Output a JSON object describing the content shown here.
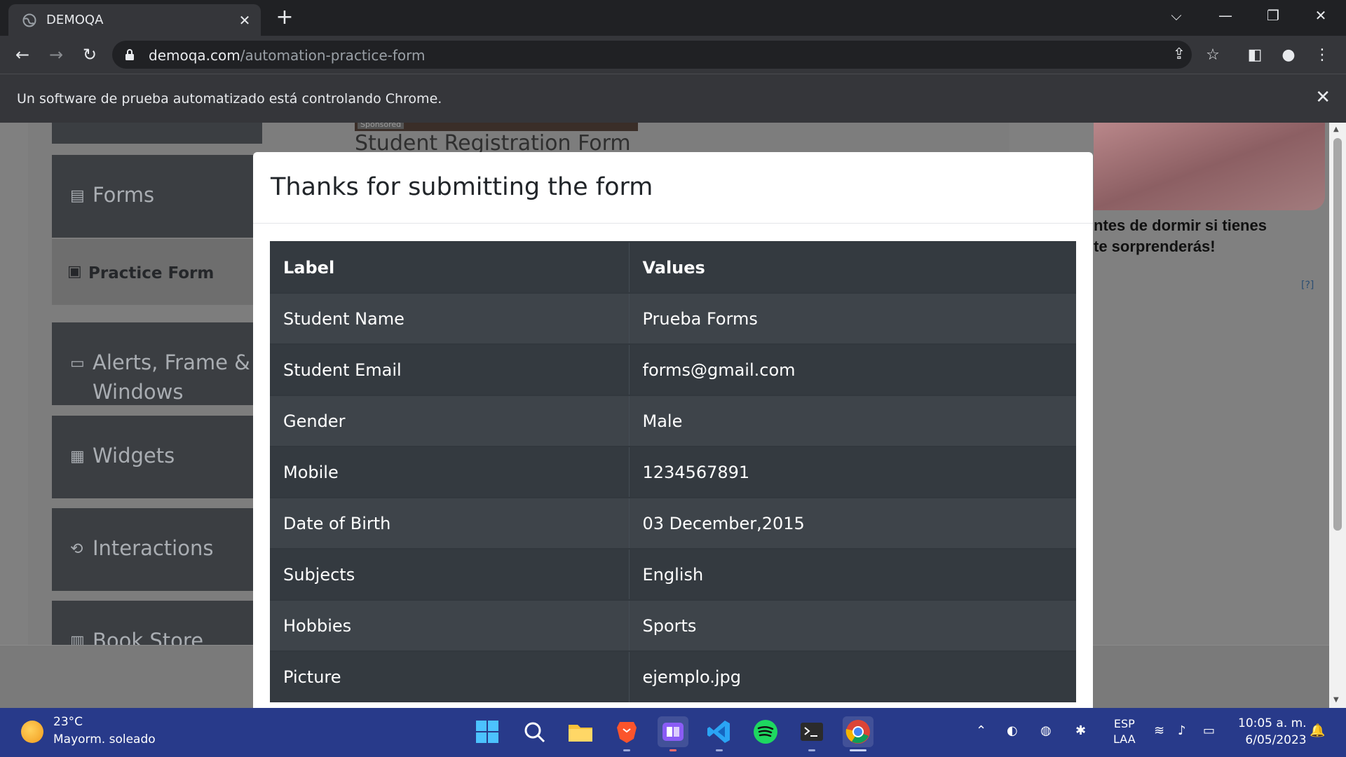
{
  "browser": {
    "tab_title": "DEMOQA",
    "tab_close": "✕",
    "new_tab": "+",
    "url_host": "demoqa.com",
    "url_path": "/automation-practice-form",
    "infobar_message": "Un software de prueba automatizado está controlando Chrome.",
    "infobar_close": "✕"
  },
  "sidebar": {
    "items": [
      {
        "label": "Forms",
        "icon": "forms-icon"
      },
      {
        "label": "Practice Form",
        "icon": "practice-form-icon"
      },
      {
        "label": "Alerts, Frame &",
        "label2": "Windows",
        "icon": "alerts-icon"
      },
      {
        "label": "Widgets",
        "icon": "widgets-icon"
      },
      {
        "label": "Interactions",
        "icon": "interactions-icon"
      },
      {
        "label": "Book Store",
        "icon": "book-store-icon"
      }
    ]
  },
  "page": {
    "heading": "Student Registration Form",
    "sponsored": "Sponsored"
  },
  "ad": {
    "line1": "ntes de dormir si tienes",
    "line2": "te sorprenderás!",
    "info": "[?]"
  },
  "modal": {
    "title": "Thanks for submitting the form",
    "headers": [
      "Label",
      "Values"
    ],
    "rows": [
      [
        "Student Name",
        "Prueba Forms"
      ],
      [
        "Student Email",
        "forms@gmail.com"
      ],
      [
        "Gender",
        "Male"
      ],
      [
        "Mobile",
        "1234567891"
      ],
      [
        "Date of Birth",
        "03 December,2015"
      ],
      [
        "Subjects",
        "English"
      ],
      [
        "Hobbies",
        "Sports"
      ],
      [
        "Picture",
        "ejemplo.jpg"
      ]
    ]
  },
  "taskbar": {
    "temperature": "23°C",
    "weather": "Mayorm. soleado",
    "lang1": "ESP",
    "lang2": "LAA",
    "time": "10:05 a. m.",
    "date": "6/05/2023"
  },
  "colors": {
    "table_dark": "#343a40",
    "table_stripe": "#3e444a",
    "taskbar": "#283a8a",
    "chrome_dark": "#202124",
    "chrome_toolbar": "#35363a"
  }
}
